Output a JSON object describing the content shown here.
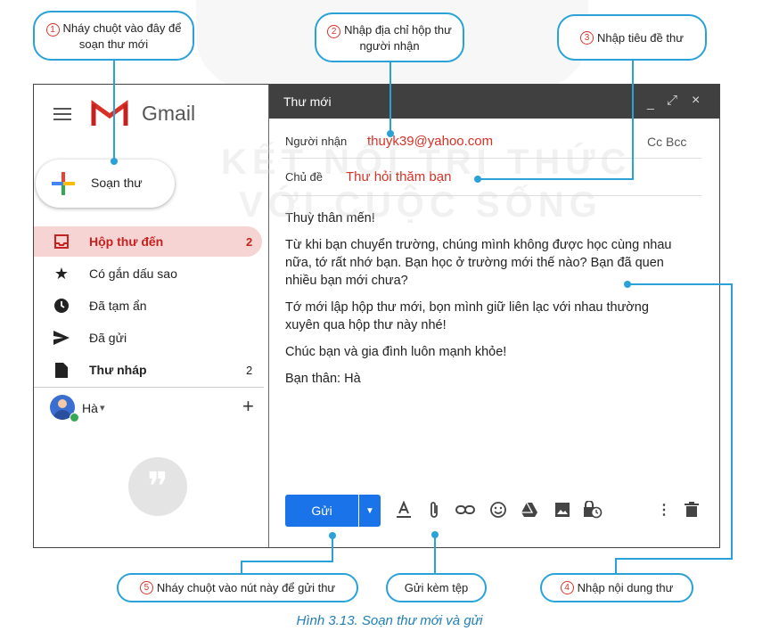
{
  "callouts": {
    "c1_num": "1",
    "c1_text": "Nháy chuột vào đây để soạn thư mới",
    "c2_num": "2",
    "c2_text": "Nhập địa chỉ hộp thư người nhận",
    "c3_num": "3",
    "c3_text": "Nhập tiêu đề thư",
    "c4_num": "4",
    "c4_text": "Nhập nội dung thư",
    "c5_num": "5",
    "c5_text": "Nháy chuột vào nút này để gửi thư",
    "attach_text": "Gửi kèm tệp"
  },
  "gmail": {
    "logo_text": "Gmail",
    "compose_label": "Soạn thư"
  },
  "sidebar": {
    "items": [
      {
        "label": "Hộp thư đến",
        "count": "2"
      },
      {
        "label": "Có gắn dấu sao",
        "count": ""
      },
      {
        "label": "Đã tạm ẩn",
        "count": ""
      },
      {
        "label": "Đã gửi",
        "count": ""
      },
      {
        "label": "Thư nháp",
        "count": "2"
      }
    ],
    "user_name": "Hà",
    "user_caret": "▾",
    "add_label": "+"
  },
  "compose_window": {
    "title": "Thư mới",
    "to_label": "Người nhận",
    "to_value": "thuyk39@yahoo.com",
    "cc_bcc": "Cc Bcc",
    "subject_label": "Chủ đề",
    "subject_value": "Thư hỏi thăm bạn",
    "body": [
      "Thuỳ thân mến!",
      "Từ khi bạn chuyển trường, chúng mình không được học cùng nhau nữa, tớ rất nhớ bạn. Bạn học ở trường mới thế nào? Bạn đã quen nhiều bạn mới chưa?",
      "Tớ mới lập hộp thư mới, bọn mình giữ liên lạc với nhau thường xuyên qua hộp thư này nhé!",
      "Chúc bạn và gia đình luôn mạnh khỏe!",
      "Bạn thân: Hà"
    ],
    "send_label": "Gửi"
  },
  "watermark": {
    "line1": "KẾT NỐI TRI THỨC",
    "line2": "VỚI CUỘC SỐNG"
  },
  "caption": "Hình 3.13. Soạn thư mới và gửi",
  "colors": {
    "accent": "#2aa2d8",
    "send_button": "#1a73e8",
    "red_text": "#d93025",
    "inbox_highlight": "#f6d4d4",
    "header_bg": "#404040"
  }
}
